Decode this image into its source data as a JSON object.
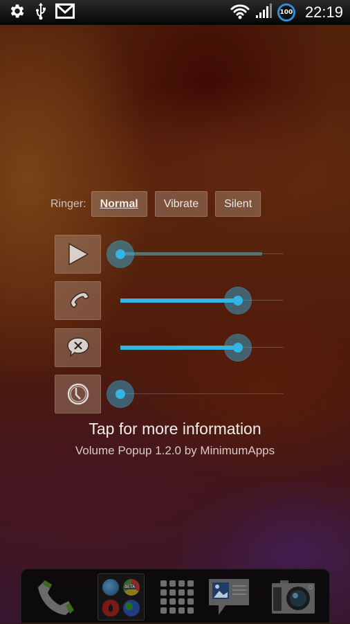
{
  "status_bar": {
    "left_icons": [
      "settings-gear-icon",
      "usb-icon",
      "gmail-icon"
    ],
    "right_icons": [
      "wifi-icon",
      "signal-icon"
    ],
    "battery_level": "100",
    "battery_color": "#2f8fd8",
    "time": "22:19"
  },
  "ringer": {
    "label": "Ringer:",
    "modes": [
      {
        "label": "Normal",
        "selected": true
      },
      {
        "label": "Vibrate",
        "selected": false
      },
      {
        "label": "Silent",
        "selected": false
      }
    ]
  },
  "volume_sliders": [
    {
      "name": "media",
      "icon": "play-icon",
      "value_fraction": 0.0,
      "secondary_fraction": 0.87
    },
    {
      "name": "ringer",
      "icon": "phone-icon",
      "value_fraction": 0.72
    },
    {
      "name": "notification",
      "icon": "notification-bubble-icon",
      "value_fraction": 0.72
    },
    {
      "name": "alarm",
      "icon": "clock-icon",
      "value_fraction": 0.0
    }
  ],
  "accent_color": "#33b5e5",
  "info": {
    "title": "Tap for more information",
    "subtitle": "Volume Popup 1.2.0 by MinimumApps"
  },
  "dock": {
    "items": [
      {
        "name": "phone",
        "icon": "phone-app-icon"
      },
      {
        "name": "browser-folder",
        "icon": "folder-icon",
        "folder_badge": "BETA"
      },
      {
        "name": "app-drawer",
        "icon": "app-grid-icon"
      },
      {
        "name": "messages",
        "icon": "messaging-icon"
      },
      {
        "name": "camera",
        "icon": "camera-icon"
      }
    ]
  }
}
